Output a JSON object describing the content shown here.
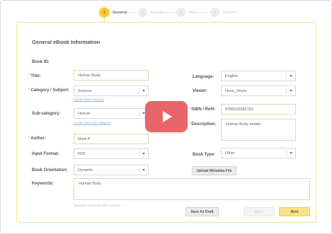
{
  "stepper": {
    "steps": [
      {
        "num": "1",
        "label": "General"
      },
      {
        "num": "2",
        "label": "Upload"
      },
      {
        "num": "3",
        "label": "TOC"
      },
      {
        "num": "4",
        "label": "Convert"
      }
    ]
  },
  "form": {
    "title": "General eBook Information",
    "book_id": {
      "label": "Book ID:",
      "value": ""
    },
    "title_field": {
      "required": "*",
      "label": "Title:",
      "value": "Human Body"
    },
    "category": {
      "required": "*",
      "label": "Category / Subject:",
      "value": "Science",
      "link": "Create New Category"
    },
    "subcategory": {
      "label": "Sub-category:",
      "value": "Human",
      "link": "Create New Sub-category"
    },
    "author": {
      "required": "*",
      "label": "Author:",
      "value": "Mark P"
    },
    "input_format": {
      "label": "Input Format:",
      "value": "PDF"
    },
    "orientation": {
      "label": "Book Orientation:",
      "value": "Dynamic"
    },
    "keywords": {
      "label": "Keywords:",
      "value": "Human Body",
      "hint": "Separate keywords with commas"
    },
    "language": {
      "label": "Language:",
      "value": "English"
    },
    "viewer": {
      "label": "Viewer:",
      "value": "Huris_Share"
    },
    "isbn": {
      "required": "*",
      "label": "ISBN / Ref#:",
      "value": "978653258215​2"
    },
    "description": {
      "required": "*",
      "label": "Description:",
      "value": "Human Body details"
    },
    "book_type": {
      "label": "Book Type:",
      "value": "Other"
    },
    "upload_metadata": "Upload Metadata File"
  },
  "actions": {
    "save_draft": "Save As Draft",
    "back": "Back",
    "next": "Next"
  },
  "colors": {
    "accent": "#f6c534",
    "play": "#e8666a",
    "field_border": "#cde3a8"
  },
  "overlay": {
    "icon": "play-icon"
  }
}
